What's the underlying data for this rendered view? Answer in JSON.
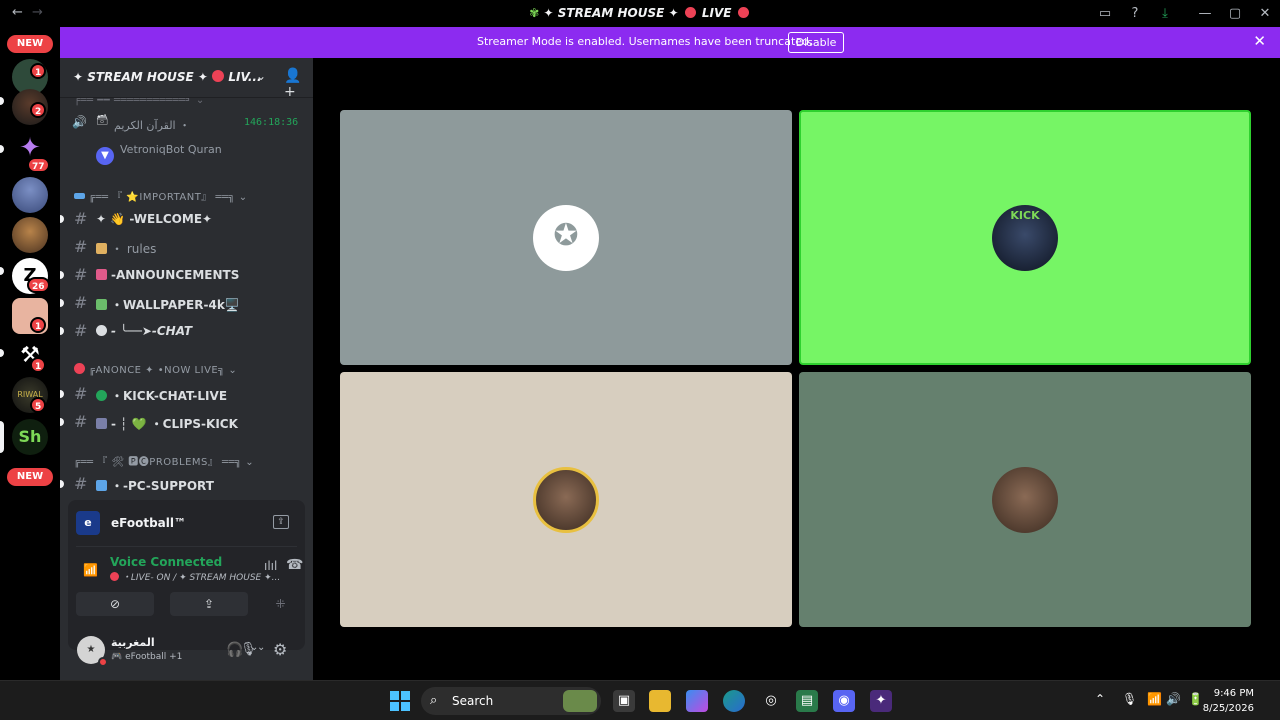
{
  "window": {
    "title_prefix": "✦ STREAM HOUSE ✦",
    "title_suffix": "LIVE",
    "nav_back": "←",
    "nav_forward": "→",
    "icons": [
      "inbox-icon",
      "help-icon",
      "download-icon",
      "minimize-icon",
      "maximize-icon",
      "close-icon"
    ]
  },
  "streamer_mode": {
    "message": "Streamer Mode is enabled. Usernames have been truncated.",
    "button": "Disable"
  },
  "server_rail": {
    "new_top": "NEW",
    "new_bottom": "NEW",
    "servers": [
      {
        "badge": "1"
      },
      {
        "badge": "2"
      },
      {
        "badge": "77"
      },
      {
        "badge": ""
      },
      {
        "badge": ""
      },
      {
        "badge": "26"
      },
      {
        "badge": "1"
      },
      {
        "badge": "1"
      },
      {
        "badge": "5"
      },
      {
        "badge": ""
      }
    ]
  },
  "guild": {
    "name": "✦ STREAM HOUSE ✦",
    "name_suffix": "LIV...",
    "voice_channel": {
      "name": "القرآن الكريم ・",
      "timer": "146:18:36"
    },
    "voice_user": "VetroniqBot Quran",
    "cat_important": "╔══ 『 ⭐IMPORTANT』 ══╗",
    "cat_annonce": "╔ANONCE ✦ •NOW LIVE╗",
    "cat_problems": "╔══ 『 🛠 🅿🅒PROBLEMS』 ══╗",
    "channels": {
      "welcome": "✦ 👋 -WELCOME✦",
      "rules": "・ rules",
      "announcements": "-ANNOUNCEMENTS",
      "wallpaper": "・WALLPAPER-4k🖥️",
      "chat": "- ╰──➤-CHAT",
      "kick_chat": "・KICK-CHAT-LIVE",
      "clips": "- ┆ 💚 ・CLIPS-KICK",
      "pc_support": "・-PC-SUPPORT"
    }
  },
  "activity": {
    "game": "eFootball™",
    "game_icon": "e",
    "voice_status": "Voice Connected",
    "voice_channel": "・LIVE- ON / ✦ STREAM HOUSE ✦..."
  },
  "user": {
    "name": "المغربية",
    "sub": "🎮 eFootball +1"
  },
  "taskbar": {
    "search": "Search",
    "time": "9:46 PM",
    "date": "8/25/2026"
  },
  "colors": {
    "streamer_bar": "#8c2bf0",
    "tile_1": "#8e9a9b",
    "tile_2": "#76f565",
    "tile_3": "#d7cebf",
    "tile_4": "#65806e",
    "speaking_border": "#2fd12f"
  }
}
